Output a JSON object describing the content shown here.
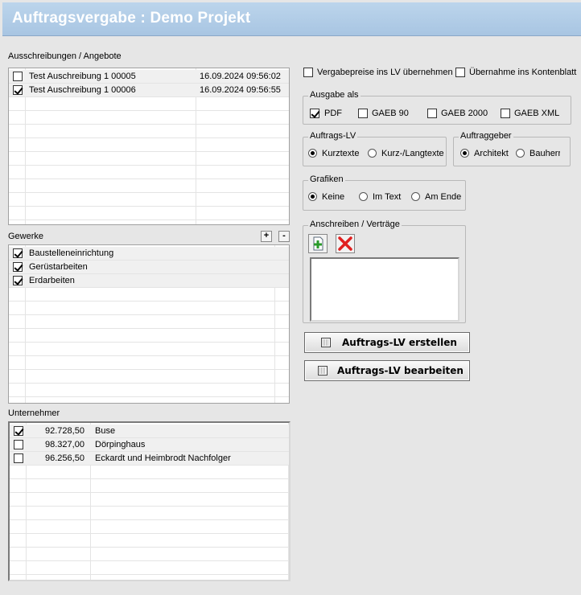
{
  "title": "Auftragsvergabe : Demo Projekt",
  "ausschreibungen": {
    "label": "Ausschreibungen / Angebote",
    "rows": [
      {
        "checked": false,
        "name": "Test Auschreibung 1 00005",
        "date": "16.09.2024 09:56:02"
      },
      {
        "checked": true,
        "name": "Test Auschreibung 1 00006",
        "date": "16.09.2024 09:56:55"
      }
    ]
  },
  "gewerke": {
    "label": "Gewerke",
    "add_label": "+",
    "remove_label": "-",
    "rows": [
      {
        "checked": true,
        "name": "Baustelleneinrichtung"
      },
      {
        "checked": true,
        "name": "Gerüstarbeiten"
      },
      {
        "checked": true,
        "name": "Erdarbeiten"
      }
    ]
  },
  "unternehmer": {
    "label": "Unternehmer",
    "rows": [
      {
        "checked": true,
        "amount": "92.728,50",
        "name": "Buse"
      },
      {
        "checked": false,
        "amount": "98.327,00",
        "name": "Dörpinghaus"
      },
      {
        "checked": false,
        "amount": "96.256,50",
        "name": "Eckardt und Heimbrodt Nachfolger"
      }
    ]
  },
  "options": {
    "vergabepreise": {
      "label": "Vergabepreise ins LV übernehmen",
      "checked": false
    },
    "kontenblatt": {
      "label": "Übernahme ins Kontenblatt",
      "checked": false
    }
  },
  "ausgabe": {
    "label": "Ausgabe als",
    "items": [
      {
        "label": "PDF",
        "checked": true
      },
      {
        "label": "GAEB 90",
        "checked": false
      },
      {
        "label": "GAEB 2000",
        "checked": false
      },
      {
        "label": "GAEB XML",
        "checked": false
      }
    ]
  },
  "auftrags_lv": {
    "label": "Auftrags-LV",
    "options": [
      {
        "label": "Kurztexte",
        "selected": true
      },
      {
        "label": "Kurz-/Langtexte",
        "selected": false
      }
    ]
  },
  "auftraggeber": {
    "label": "Auftraggeber",
    "options": [
      {
        "label": "Architekt",
        "selected": true
      },
      {
        "label": "Bauherr",
        "selected": false
      }
    ]
  },
  "grafiken": {
    "label": "Grafiken",
    "options": [
      {
        "label": "Keine",
        "selected": true
      },
      {
        "label": "Im Text",
        "selected": false
      },
      {
        "label": "Am Ende",
        "selected": false
      }
    ]
  },
  "anschreiben": {
    "label": "Anschreiben / Verträge",
    "add_icon": "add-document-icon",
    "delete_icon": "delete-x-icon"
  },
  "buttons": {
    "erstellen": "Auftrags-LV erstellen",
    "bearbeiten": "Auftrags-LV bearbeiten"
  },
  "colors": {
    "title_bar": "#b1cbe6",
    "background": "#e6e6e6",
    "delete_red": "#e02020",
    "add_green": "#2a9a2a"
  }
}
